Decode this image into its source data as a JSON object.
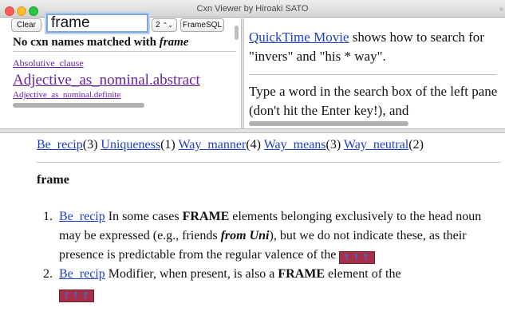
{
  "window": {
    "title": "Cxn Viewer by Hiroaki SATO",
    "title_edge": "»"
  },
  "left_pane": {
    "clear_label": "Clear",
    "search_value": "frame",
    "stepper_value": "2",
    "stepper_arrows": "⌃⌄",
    "framesql_label": "FrameSQL",
    "no_match_prefix": "No cxn names matched with ",
    "no_match_term": "frame",
    "names": [
      "Absolutive_clause",
      "Adjective_as_nominal.abstract",
      "Adjective_as_nominal.definite"
    ]
  },
  "right_pane": {
    "link": "QuickTime Movie",
    "text1": " shows how to search for \"invers\" and \"his * way\".",
    "text2": "Type a word in the search box of the left pane (don't hit the Enter key!), and"
  },
  "bottom_pane": {
    "tags": [
      {
        "name": "Be_recip",
        "count": "(3)"
      },
      {
        "name": "Uniqueness",
        "count": "(1)"
      },
      {
        "name": "Way_manner",
        "count": "(4)"
      },
      {
        "name": "Way_means",
        "count": "(3)"
      },
      {
        "name": "Way_neutral",
        "count": "(2)"
      }
    ],
    "section_title": "frame",
    "results": [
      {
        "num": "1.",
        "link": "Be_recip",
        "t1": " In some cases ",
        "b1": "FRAME",
        "t2": " elements belonging exclusively to the head noun may be expressed (e.g., friends ",
        "em": "from Uni",
        "t3": "), but we do not indicate these, as their presence is predictable from the regular valence of the ",
        "box": "↑↑↑"
      },
      {
        "num": "2.",
        "link": "Be_recip",
        "t1": " Modifier, when present, is also a ",
        "b1": "FRAME",
        "t2": " element of the ",
        "box": "↑↑↑"
      }
    ]
  }
}
